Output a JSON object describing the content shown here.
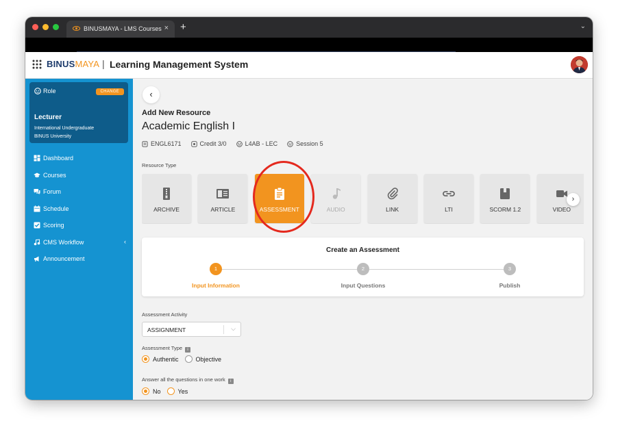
{
  "browser": {
    "tab_title": "BINUSMAYA - LMS Courses",
    "close_glyph": "×",
    "new_tab_glyph": "+",
    "menu_glyph": "⌄"
  },
  "header": {
    "brand_main": "BINUS",
    "brand_accent": "MAYA",
    "separator": "|",
    "title": "Learning Management System"
  },
  "role": {
    "label": "Role",
    "change_label": "CHANGE",
    "name": "Lecturer",
    "line1": "International Undergraduate",
    "line2": "BINUS University"
  },
  "sidebar": {
    "items": [
      {
        "label": "Dashboard",
        "icon": "dashboard-icon"
      },
      {
        "label": "Courses",
        "icon": "graduation-cap-icon"
      },
      {
        "label": "Forum",
        "icon": "chat-icon"
      },
      {
        "label": "Schedule",
        "icon": "calendar-icon"
      },
      {
        "label": "Scoring",
        "icon": "checkbox-icon"
      },
      {
        "label": "CMS Workflow",
        "icon": "workflow-icon"
      },
      {
        "label": "Announcement",
        "icon": "megaphone-icon"
      }
    ],
    "expand_glyph": "‹"
  },
  "main": {
    "back_glyph": "‹",
    "add_label": "Add New Resource",
    "course_name": "Academic English I",
    "meta": {
      "code": "ENGL6171",
      "credit": "Credit 3/0",
      "class": "L4AB - LEC",
      "session": "Session 5"
    },
    "resource_type_label": "Resource Type",
    "resource_types": [
      {
        "label": "ARCHIVE",
        "icon": "archive-icon",
        "state": "normal"
      },
      {
        "label": "ARTICLE",
        "icon": "article-icon",
        "state": "normal"
      },
      {
        "label": "ASSESSMENT",
        "icon": "clipboard-icon",
        "state": "selected"
      },
      {
        "label": "AUDIO",
        "icon": "music-note-icon",
        "state": "disabled"
      },
      {
        "label": "LINK",
        "icon": "paperclip-icon",
        "state": "normal"
      },
      {
        "label": "LTI",
        "icon": "chain-link-icon",
        "state": "normal"
      },
      {
        "label": "SCORM 1.2",
        "icon": "package-icon",
        "state": "normal"
      },
      {
        "label": "VIDEO",
        "icon": "video-camera-icon",
        "state": "normal"
      }
    ],
    "next_glyph": "›",
    "stepper": {
      "title": "Create an Assessment",
      "steps": [
        {
          "number": "1",
          "label": "Input Information",
          "active": true
        },
        {
          "number": "2",
          "label": "Input Questions",
          "active": false
        },
        {
          "number": "3",
          "label": "Publish",
          "active": false
        }
      ]
    },
    "form": {
      "activity_label": "Assessment Activity",
      "activity_value": "ASSIGNMENT",
      "type_label": "Assessment Type",
      "type_options": [
        "Authentic",
        "Objective"
      ],
      "type_selected": "Authentic",
      "one_work_label": "Answer all the questions in one work",
      "one_work_options": [
        "No",
        "Yes"
      ],
      "one_work_selected": "No"
    }
  },
  "colors": {
    "accent": "#f2941f",
    "sidebar": "#1593d1",
    "role_card": "#0e5c8a",
    "highlight": "#e4291e"
  }
}
